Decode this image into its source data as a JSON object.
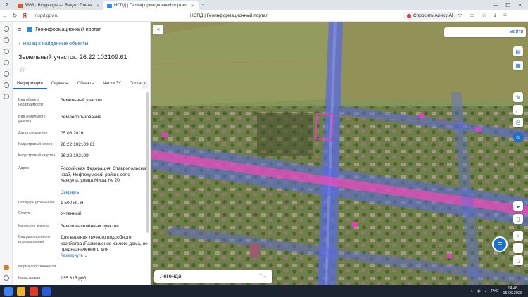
{
  "browser": {
    "tab_count": "2",
    "tabs": [
      {
        "title": "3983 · Входящие — Яндекс Почта",
        "color": "#e0592a"
      },
      {
        "title": "НСПД | Геоинформационный портал",
        "color": "#2a8be2",
        "active": true
      }
    ],
    "new_tab": "+",
    "url": "nspd.gov.ru",
    "page_title": "НСПД | Геоинформационный портал",
    "alice_label": "Спросить Алису AI"
  },
  "app": {
    "name": "Геоинформационный портал",
    "back_link": "Назад в найденные объекты",
    "title": "Земельный участок: 26:22:102109:61",
    "tabs": [
      "Информация",
      "Сервисы",
      "Объекты",
      "Части ЗУ",
      "Состав"
    ],
    "fields": [
      {
        "label": "Вид объекта недвижимости",
        "value": "Земельный участок"
      },
      {
        "label": "Вид земельного участка",
        "value": "Землепользование"
      },
      {
        "label": "Дата присвоения",
        "value": "05.08.2016"
      },
      {
        "label": "Кадастровый номер",
        "value": "26:22:102109:61"
      },
      {
        "label": "Кадастровый квартал",
        "value": "26:22:102109"
      },
      {
        "label": "Адрес",
        "value": "Российская Федерация, Ставропольский край, Нефтекумский район, село Каясула, улица Мира, № 20"
      },
      {
        "label": "Площадь уточненная",
        "value": "1 500 кв. м"
      },
      {
        "label": "Статус",
        "value": "Учтенный"
      },
      {
        "label": "Категория земель",
        "value": "Земли населённых пунктов"
      },
      {
        "label": "Вид разрешенного использования",
        "value": "Для ведения личного подсобного хозяйства (Размещение жилого дома, не предназначенного для"
      },
      {
        "label": "Форма собственности",
        "value": "-"
      },
      {
        "label": "Кадастровая",
        "value": "135 315 руб."
      }
    ],
    "collapse_link": "Свернуть",
    "expand_link": "Развернуть"
  },
  "map": {
    "login_label": "Войти",
    "legend_label": "Легенда"
  },
  "taskbar": {
    "lang": "РУС",
    "time": "14:46",
    "date": "15.05.2026"
  },
  "colors": {
    "accent": "#1b6fd0",
    "parcel_magenta": "#e040c0",
    "road_blue": "#4a5ce8"
  }
}
